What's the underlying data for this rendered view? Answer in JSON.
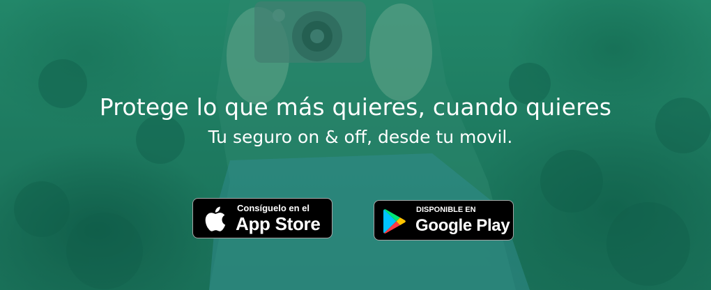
{
  "hero": {
    "headline": "Protege lo que más quieres, cuando quieres",
    "subline": "Tu seguro on & off, desde tu movil.",
    "overlay_color": "#14826480"
  },
  "badges": {
    "app_store": {
      "small_label": "Consíguelo en el",
      "big_label": "App Store",
      "icon": "apple-icon"
    },
    "google_play": {
      "small_label": "DISPONIBLE EN",
      "big_label": "Google Play",
      "icon": "google-play-icon"
    }
  }
}
